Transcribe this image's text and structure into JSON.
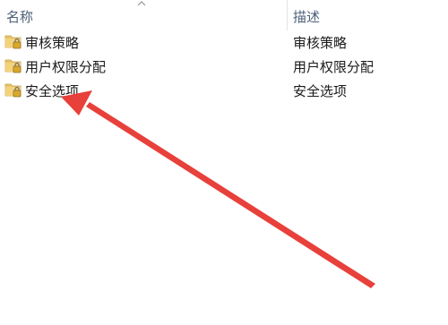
{
  "columns": {
    "name_header": "名称",
    "description_header": "描述"
  },
  "rows": [
    {
      "name": "审核策略",
      "description": "审核策略",
      "icon": "folder-lock-icon"
    },
    {
      "name": "用户权限分配",
      "description": "用户权限分配",
      "icon": "folder-lock-icon"
    },
    {
      "name": "安全选项",
      "description": "安全选项",
      "icon": "folder-lock-icon"
    }
  ],
  "annotation": {
    "type": "arrow",
    "color": "#e8403a",
    "points_to": "安全选项"
  }
}
